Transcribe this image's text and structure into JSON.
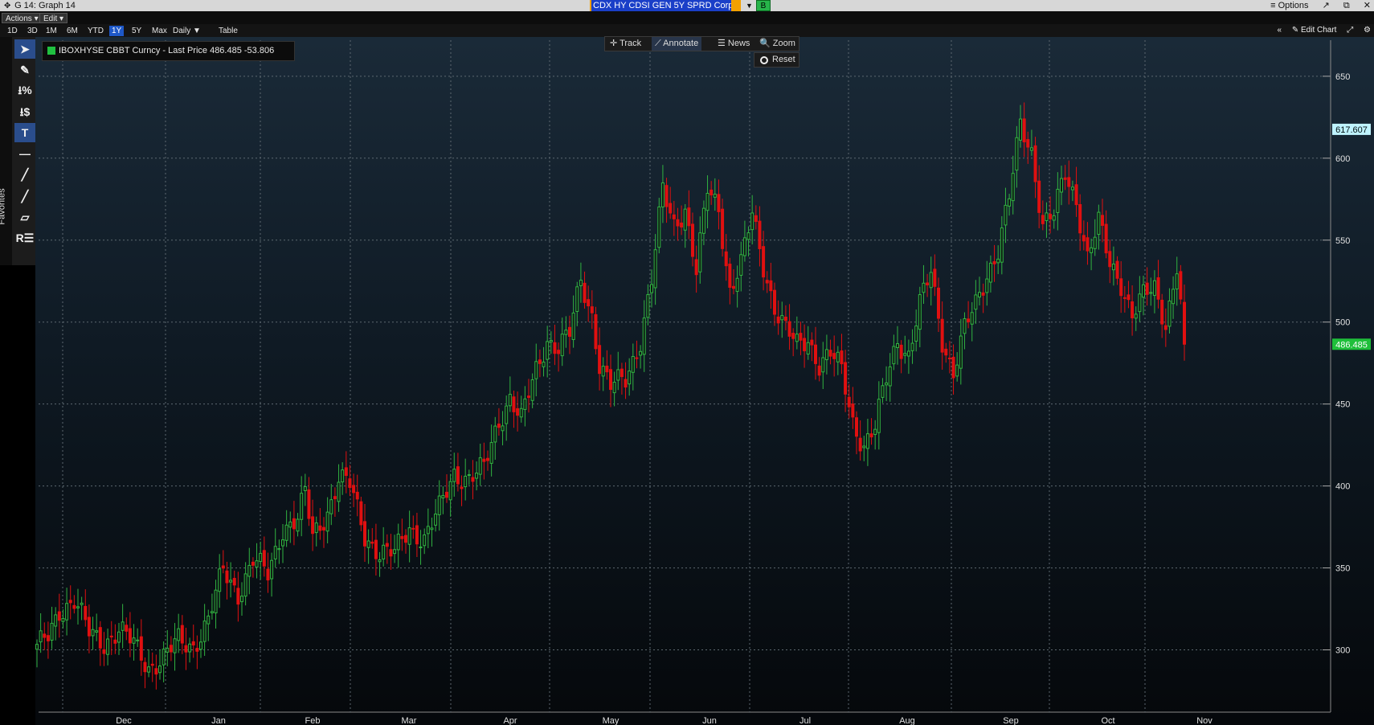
{
  "titlebar": {
    "title": "G 14: Graph 14",
    "security": "CDX HY CDSI GEN 5Y SPRD Corp",
    "button_b": "B",
    "options": "≡ Options",
    "popout": "↗",
    "restore": "⧉",
    "close": "✕"
  },
  "menubar": {
    "actions": "Actions ▾",
    "edit": "Edit ▾"
  },
  "rangebar": {
    "ranges": [
      "1D",
      "3D",
      "1M",
      "6M",
      "YTD",
      "1Y",
      "5Y",
      "Max"
    ],
    "active": "1Y",
    "frequency": "Daily ▼",
    "table": "Table",
    "collapse": "«",
    "edit_chart": "✎ Edit Chart",
    "pop": "⤢",
    "settings": "⚙"
  },
  "tools": {
    "favorites": "Favorites",
    "items": [
      "➤",
      "✎",
      "⭳%",
      "⭳$",
      "T",
      "—",
      "╱",
      "╱",
      "▱",
      "R☰"
    ]
  },
  "legend": {
    "label": "IBOXHYSE CBBT Curncy - Last Price 486.485  -53.806",
    "color": "#20c040"
  },
  "chart_tools": {
    "track": "✛ Track",
    "annotate": "⟋ Annotate",
    "news": "☰ News",
    "zoom": "🔍 Zoom",
    "reset": "Reset"
  },
  "chart_data": {
    "type": "candlestick",
    "series_name": "IBOXHYSE CBBT Curncy - Last Price",
    "last_price": 486.485,
    "change": -53.806,
    "ylim": [
      262,
      672
    ],
    "yticks": [
      300,
      350,
      400,
      450,
      500,
      550,
      600,
      650
    ],
    "y_markers": [
      {
        "label": "617.607",
        "value": 617.607,
        "color": "#bff3ff",
        "text_color": "#001010"
      },
      {
        "label": "486.485",
        "value": 486.485,
        "color": "#1fbf3a",
        "text_color": "#ffffff"
      }
    ],
    "xlabels": [
      "Dec",
      "Jan",
      "Feb",
      "Mar",
      "Apr",
      "May",
      "Jun",
      "Jul",
      "Aug",
      "Sep",
      "Oct",
      "Nov"
    ],
    "up_color": "#31b341",
    "down_color": "#e01010",
    "close_anchors": [
      [
        0,
        300
      ],
      [
        3,
        308
      ],
      [
        6,
        325
      ],
      [
        10,
        330
      ],
      [
        14,
        310
      ],
      [
        18,
        305
      ],
      [
        22,
        312
      ],
      [
        26,
        303
      ],
      [
        30,
        290
      ],
      [
        34,
        295
      ],
      [
        38,
        305
      ],
      [
        42,
        303
      ],
      [
        46,
        318
      ],
      [
        50,
        348
      ],
      [
        54,
        335
      ],
      [
        58,
        355
      ],
      [
        62,
        345
      ],
      [
        66,
        375
      ],
      [
        70,
        380
      ],
      [
        72,
        395
      ],
      [
        74,
        368
      ],
      [
        78,
        385
      ],
      [
        81,
        405
      ],
      [
        84,
        400
      ],
      [
        88,
        370
      ],
      [
        92,
        360
      ],
      [
        96,
        358
      ],
      [
        100,
        375
      ],
      [
        104,
        368
      ],
      [
        108,
        385
      ],
      [
        112,
        408
      ],
      [
        116,
        405
      ],
      [
        120,
        410
      ],
      [
        124,
        440
      ],
      [
        127,
        455
      ],
      [
        130,
        440
      ],
      [
        134,
        470
      ],
      [
        137,
        490
      ],
      [
        140,
        485
      ],
      [
        143,
        492
      ],
      [
        146,
        525
      ],
      [
        149,
        505
      ],
      [
        151,
        475
      ],
      [
        154,
        460
      ],
      [
        158,
        465
      ],
      [
        162,
        490
      ],
      [
        165,
        525
      ],
      [
        168,
        580
      ],
      [
        171,
        560
      ],
      [
        174,
        570
      ],
      [
        177,
        530
      ],
      [
        180,
        580
      ],
      [
        183,
        570
      ],
      [
        186,
        520
      ],
      [
        189,
        535
      ],
      [
        192,
        565
      ],
      [
        195,
        535
      ],
      [
        198,
        510
      ],
      [
        201,
        495
      ],
      [
        204,
        485
      ],
      [
        207,
        490
      ],
      [
        210,
        475
      ],
      [
        213,
        480
      ],
      [
        216,
        470
      ],
      [
        219,
        440
      ],
      [
        222,
        425
      ],
      [
        225,
        435
      ],
      [
        228,
        465
      ],
      [
        231,
        490
      ],
      [
        234,
        480
      ],
      [
        237,
        510
      ],
      [
        240,
        530
      ],
      [
        243,
        490
      ],
      [
        246,
        470
      ],
      [
        249,
        495
      ],
      [
        252,
        510
      ],
      [
        255,
        530
      ],
      [
        258,
        545
      ],
      [
        261,
        575
      ],
      [
        264,
        620
      ],
      [
        267,
        605
      ],
      [
        270,
        560
      ],
      [
        273,
        565
      ],
      [
        276,
        590
      ],
      [
        279,
        575
      ],
      [
        282,
        540
      ],
      [
        285,
        560
      ],
      [
        288,
        535
      ],
      [
        291,
        525
      ],
      [
        294,
        505
      ],
      [
        297,
        515
      ],
      [
        300,
        520
      ],
      [
        303,
        500
      ],
      [
        306,
        535
      ],
      [
        308,
        486.485
      ]
    ]
  }
}
